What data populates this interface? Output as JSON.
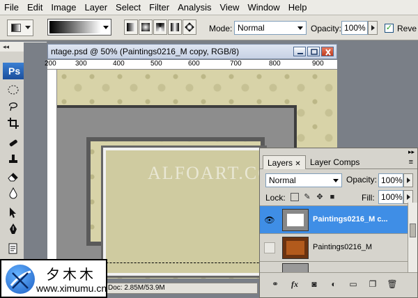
{
  "menubar": {
    "items": [
      "File",
      "Edit",
      "Image",
      "Layer",
      "Select",
      "Filter",
      "Analysis",
      "View",
      "Window",
      "Help"
    ]
  },
  "options": {
    "mode_label": "Mode:",
    "mode_value": "Normal",
    "opacity_label": "Opacity:",
    "opacity_value": "100%",
    "reverse_label": "Reve"
  },
  "toolbox": {
    "logo": "Ps"
  },
  "document": {
    "title": "ntage.psd @ 50% (Paintings0216_M copy, RGB/8)",
    "ruler_top": [
      "200",
      "300",
      "400",
      "500",
      "600",
      "700",
      "800",
      "900"
    ],
    "status": "Doc: 2.85M/53.9M",
    "watermark": "ALFOART.COM"
  },
  "layers_panel": {
    "tabs": [
      "Layers",
      "Layer Comps"
    ],
    "blend_mode": "Normal",
    "opacity_label": "Opacity:",
    "opacity_value": "100%",
    "lock_label": "Lock:",
    "fill_label": "Fill:",
    "fill_value": "100%",
    "layers": [
      {
        "name": "Paintings0216_M c...",
        "selected": true,
        "visible": true
      },
      {
        "name": "Paintings0216_M",
        "selected": false,
        "visible": false
      }
    ],
    "bottom_icons": [
      "link-icon",
      "fx-icon",
      "mask-icon",
      "adjustment-icon",
      "group-icon",
      "new-layer-icon",
      "trash-icon"
    ],
    "fx_label": "fx"
  },
  "watermark_logo": {
    "chinese": "夕木木",
    "url": "www.ximumu.cn"
  },
  "colors": {
    "selection_blue": "#3f8ee6",
    "canvas_bg": "#d8d3a8",
    "ps_blue": "#1c4f9c"
  }
}
